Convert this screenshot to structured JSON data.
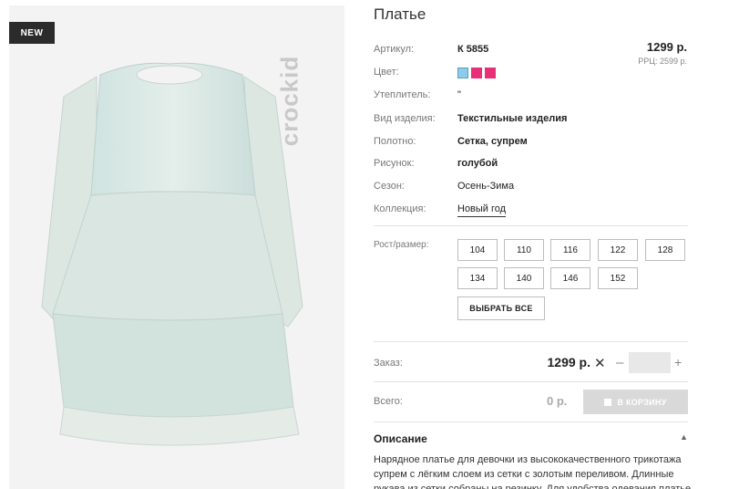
{
  "badge": "NEW",
  "brand": "crockid",
  "product": {
    "title": "Платье",
    "price": "1299 р.",
    "rrp": "РРЦ: 2599 р."
  },
  "attributes": [
    {
      "label": "Артикул:",
      "value": "К 5855"
    },
    {
      "label": "Цвет:",
      "value": ""
    },
    {
      "label": "Утеплитель:",
      "value": "\""
    },
    {
      "label": "Вид изделия:",
      "value": "Текстильные изделия"
    },
    {
      "label": "Полотно:",
      "value": "Сетка, супрем"
    },
    {
      "label": "Рисунок:",
      "value": "голубой"
    },
    {
      "label": "Сезон:",
      "value": "Осень-Зима"
    },
    {
      "label": "Коллекция:",
      "value": "Новый год"
    }
  ],
  "colors": [
    "#8ecbe8",
    "#e8307a",
    "#e8307a"
  ],
  "sizes": {
    "label": "Рост/размер:",
    "options": [
      "104",
      "110",
      "116",
      "122",
      "128",
      "134",
      "140",
      "146",
      "152"
    ],
    "select_all": "ВЫБРАТЬ ВСЕ"
  },
  "order": {
    "label": "Заказ:",
    "price": "1299 р.",
    "times": "✕",
    "minus": "–",
    "plus": "+",
    "quantity": ""
  },
  "total": {
    "label": "Всего:",
    "value": "0 р.",
    "cart_button": "В КОРЗИНУ"
  },
  "description": {
    "title": "Описание",
    "toggle": "▲",
    "text": "Нарядное платье для девочки из высококачественного трикотажа супрем с лёгким слоем из сетки с золотым переливом. Длинные рукава из сетки собраны на резинку. Для удобства одевания платье"
  }
}
